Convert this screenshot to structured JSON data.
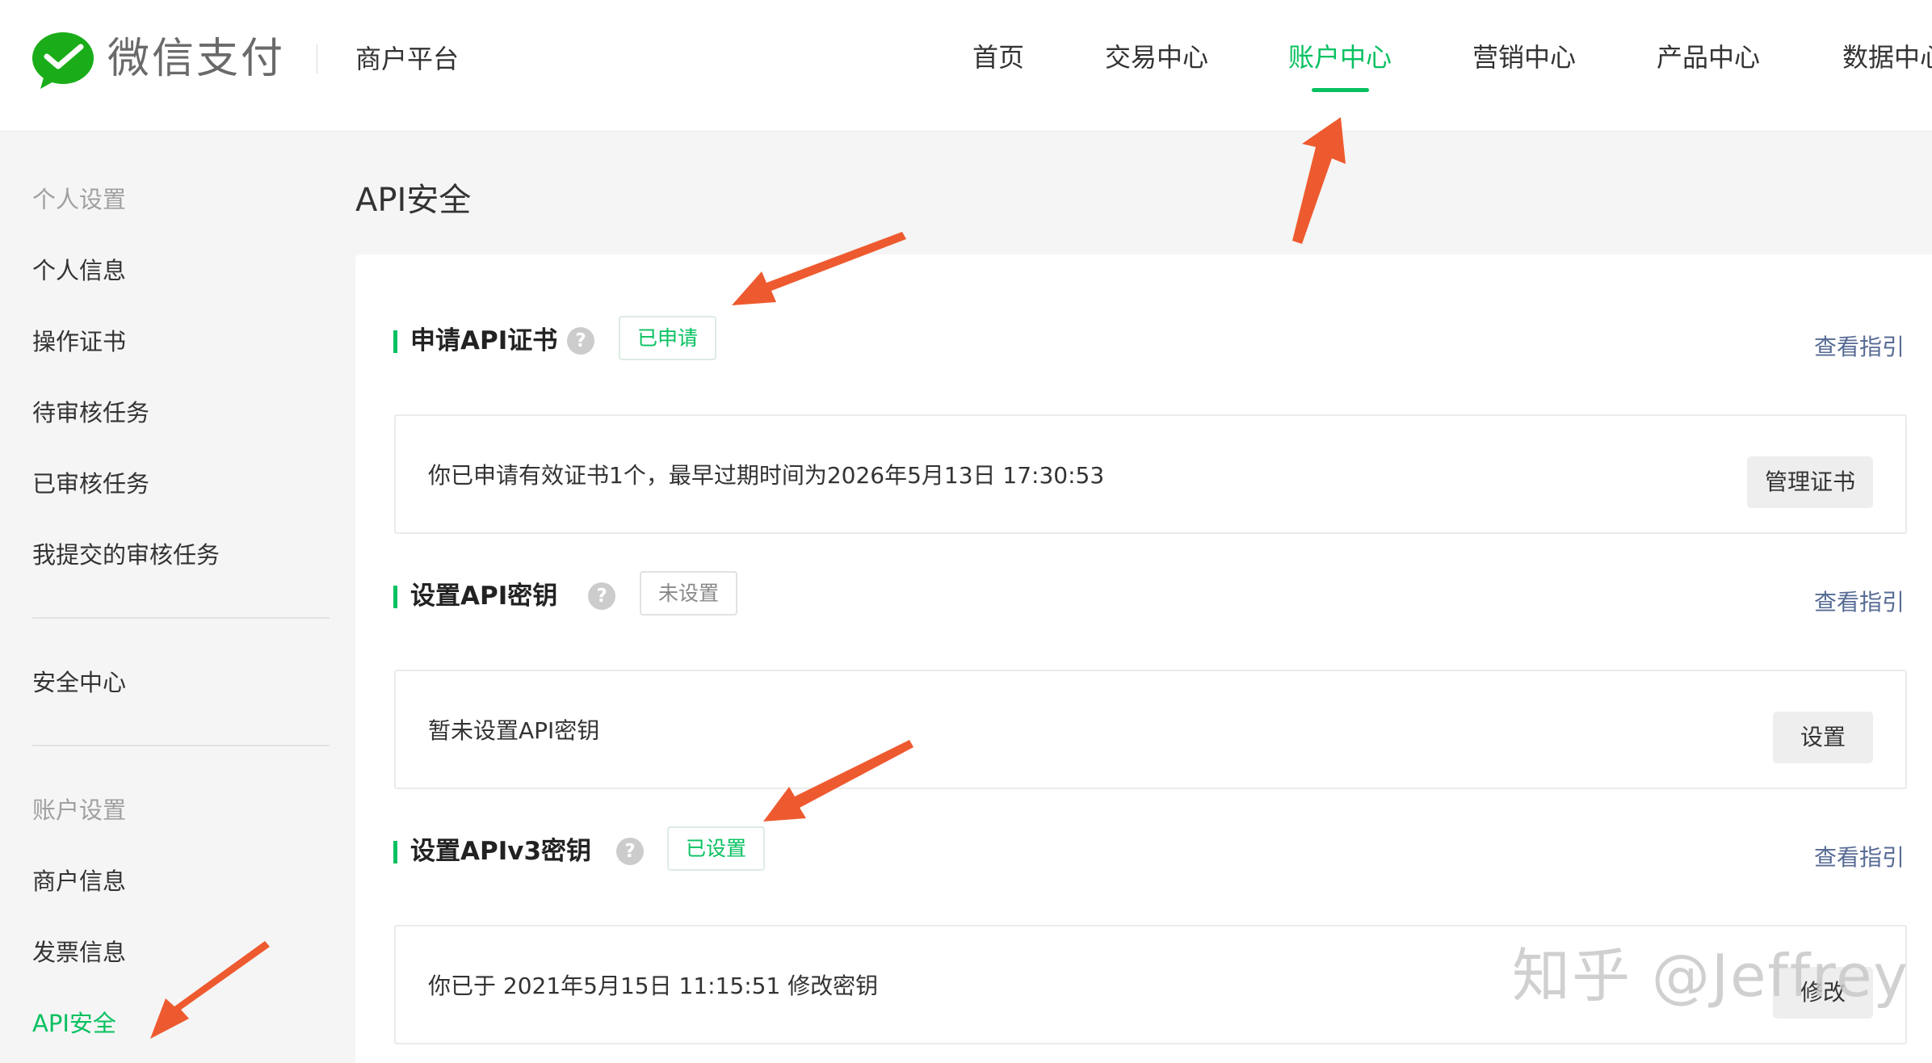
{
  "header": {
    "brand": "微信支付",
    "platform": "商户平台",
    "nav": [
      {
        "label": "首页",
        "active": false
      },
      {
        "label": "交易中心",
        "active": false
      },
      {
        "label": "账户中心",
        "active": true
      },
      {
        "label": "营销中心",
        "active": false
      },
      {
        "label": "产品中心",
        "active": false
      },
      {
        "label": "数据中心",
        "active": false
      }
    ]
  },
  "sidebar": {
    "group1": "个人设置",
    "items1": [
      "个人信息",
      "操作证书",
      "待审核任务",
      "已审核任务",
      "我提交的审核任务"
    ],
    "security_center": "安全中心",
    "group2": "账户设置",
    "items2": [
      "商户信息",
      "发票信息",
      "API安全"
    ],
    "active_item": "API安全"
  },
  "main": {
    "title": "API安全",
    "sections": [
      {
        "title": "申请API证书",
        "help": "?",
        "status": "已申请",
        "guide": "查看指引",
        "description": "你已申请有效证书1个，最早过期时间为2026年5月13日 17:30:53",
        "button": "管理证书"
      },
      {
        "title": "设置API密钥",
        "help": "?",
        "status": "未设置",
        "guide": "查看指引",
        "description": "暂未设置API密钥",
        "button": "设置"
      },
      {
        "title": "设置APIv3密钥",
        "help": "?",
        "status": "已设置",
        "guide": "查看指引",
        "description": "你已于 2021年5月15日 11:15:51 修改密钥",
        "button": "修改"
      }
    ]
  },
  "watermark": "知乎 @Jeffrey",
  "colors": {
    "brand_green": "#07c160",
    "link_blue": "#576b95",
    "annotation_arrow": "#ee5a2f"
  }
}
